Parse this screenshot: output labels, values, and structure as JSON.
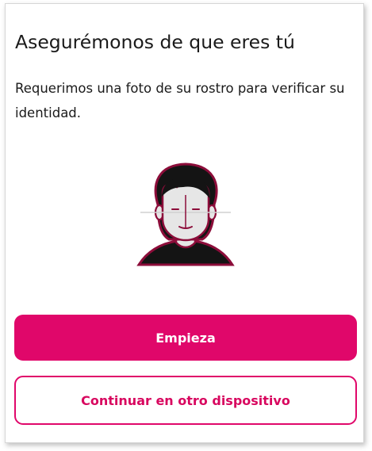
{
  "page": {
    "title": "Asegurémonos de que eres tú",
    "description": "Requerimos una foto de su rostro para verificar su identidad.",
    "illustration": {
      "icon": "face-scan-icon"
    }
  },
  "actions": {
    "start_label": "Empieza",
    "other_device_label": "Continuar en otro dispositivo"
  },
  "colors": {
    "accent": "#e0076a",
    "illustration_outline": "#8c0d3a",
    "text": "#1a1a1a"
  }
}
